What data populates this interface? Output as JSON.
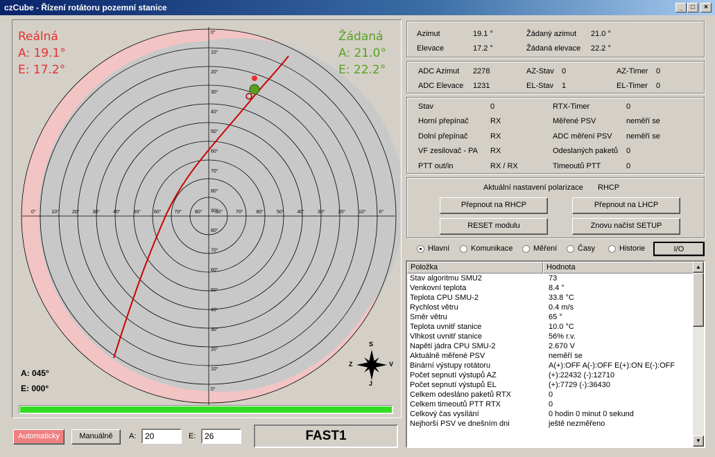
{
  "window": {
    "title": "czCube - Řízení rotátoru pozemní stanice"
  },
  "radar": {
    "real_title": "Reálná",
    "real_a": "A: 19.1°",
    "real_e": "E: 17.2°",
    "target_title": "Žádaná",
    "target_a": "A: 21.0°",
    "target_e": "E: 22.2°",
    "bottom_a": "A:  045°",
    "bottom_e": "E:  000°",
    "ring_labels_vertical": [
      "0°",
      "10°",
      "20°",
      "30°",
      "40°",
      "50°",
      "60°",
      "70°",
      "80°",
      "90°",
      "80°",
      "70°",
      "60°",
      "50°",
      "40°",
      "30°",
      "20°",
      "10°",
      "0°"
    ],
    "ring_labels_horizontal": [
      "0°",
      "10°",
      "20°",
      "30°",
      "40°",
      "50°",
      "60°",
      "70°",
      "80°",
      "90°",
      "70°",
      "60°",
      "50°",
      "40°",
      "30°",
      "20°",
      "10°",
      "0°"
    ],
    "compass": {
      "n": "S",
      "s": "J",
      "w": "Z",
      "e": "V"
    },
    "progress": 1.0
  },
  "position": {
    "azimut_label": "Azimut",
    "azimut_value": "19.1 °",
    "elevace_label": "Elevace",
    "elevace_value": "17.2 °",
    "zad_azimut_label": "Žádaný azimut",
    "zad_azimut_value": "21.0 °",
    "zad_elevace_label": "Žádaná elevace",
    "zad_elevace_value": "22.2 °"
  },
  "adc": {
    "adc_az_label": "ADC Azimut",
    "adc_az_value": "2278",
    "adc_el_label": "ADC Elevace",
    "adc_el_value": "1231",
    "az_stav_label": "AZ-Stav",
    "az_stav_value": "0",
    "el_stav_label": "EL-Stav",
    "el_stav_value": "1",
    "az_timer_label": "AZ-Timer",
    "az_timer_value": "0",
    "el_timer_label": "EL-Timer",
    "el_timer_value": "0"
  },
  "status": {
    "left": [
      {
        "label": "Stav",
        "value": "0"
      },
      {
        "label": "Horní přepínač",
        "value": "RX"
      },
      {
        "label": "Dolní přepínač",
        "value": "RX"
      },
      {
        "label": "VF zesilovač - PA",
        "value": "RX"
      },
      {
        "label": "PTT out/in",
        "value": "RX / RX"
      }
    ],
    "right": [
      {
        "label": "RTX-Timer",
        "value": "0"
      },
      {
        "label": "Měřené PSV",
        "value": "neměří se"
      },
      {
        "label": "ADC měření PSV",
        "value": "neměří se"
      },
      {
        "label": "Odeslaných paketů",
        "value": "0"
      },
      {
        "label": "Timeoutů PTT",
        "value": "0"
      }
    ]
  },
  "polarization": {
    "label": "Aktuální nastavení polarizace",
    "value": "RHCP",
    "btn_rhcp": "Přepnout na RHCP",
    "btn_lhcp": "Přepnout na LHCP",
    "btn_reset": "RESET modulu",
    "btn_setup": "Znovu načíst SETUP"
  },
  "tabs": {
    "items": [
      "Hlavní",
      "Komunikace",
      "Měření",
      "Časy",
      "Historie"
    ],
    "selected": "Hlavní",
    "io_button": "I/O"
  },
  "table": {
    "col1": "Položka",
    "col2": "Hodnota",
    "rows": [
      [
        "Stav algoritmu SMU2",
        "73"
      ],
      [
        "Venkovní teplota",
        "8.4 °"
      ],
      [
        "Teplota CPU SMU-2",
        "33.8 °C"
      ],
      [
        "Rychlost větru",
        "0.4 m/s"
      ],
      [
        "Směr větru",
        "65 °"
      ],
      [
        "Teplota uvnitř stanice",
        "10.0 °C"
      ],
      [
        "Vlhkost uvnitř stanice",
        "56%  r.v."
      ],
      [
        "Napětí jádra CPU SMU-2",
        "2.670 V"
      ],
      [
        "Aktuálně měřené PSV",
        "neměří se"
      ],
      [
        "Binární výstupy rotátoru",
        "A(+):OFF A(-):OFF E(+):ON E(-):OFF"
      ],
      [
        "Počet sepnutí výstupů AZ",
        "(+):22432  (-):12710"
      ],
      [
        "Počet sepnutí výstupů EL",
        "(+):7729  (-):36430"
      ],
      [
        "Celkem odesláno paketů RTX",
        "0"
      ],
      [
        "Celkem timeoutů PTT RTX",
        "0"
      ],
      [
        "Celkový čas vysílání",
        "0 hodin 0 minut 0 sekund"
      ],
      [
        "Nejhorší PSV ve dnešním dni",
        "ještě nezměřeno"
      ]
    ]
  },
  "controls": {
    "auto_button": "Automaticky",
    "manual_button": "Manuálně",
    "a_label": "A:",
    "a_value": "20",
    "e_label": "E:",
    "e_value": "26",
    "mode_display": "FAST1"
  },
  "colors": {
    "real": "#e83030",
    "target": "#5aa020",
    "track": "#cc0000",
    "band": "#f2c4c4",
    "progress": "#33dd22"
  }
}
